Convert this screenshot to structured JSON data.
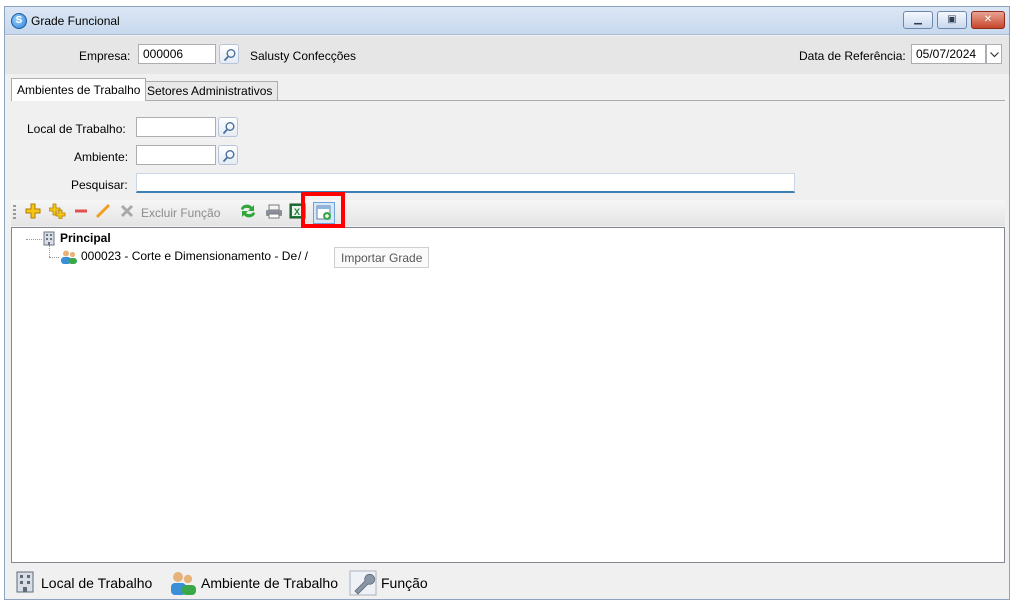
{
  "window": {
    "title": "Grade Funcional"
  },
  "header": {
    "empresa_label": "Empresa:",
    "empresa_code": "000006",
    "empresa_name": "Salusty Confecções",
    "data_ref_label": "Data de Referência:",
    "data_ref_value": "05/07/2024"
  },
  "tabs": [
    {
      "label": "Ambientes de Trabalho",
      "active": true
    },
    {
      "label": "Setores Administrativos",
      "active": false
    }
  ],
  "filters": {
    "local_label": "Local de Trabalho:",
    "local_value": "",
    "ambiente_label": "Ambiente:",
    "ambiente_value": "",
    "pesquisar_label": "Pesquisar:",
    "pesquisar_value": ""
  },
  "toolbar": {
    "excluir_label": "Excluir Função",
    "icons": [
      "add-icon",
      "add-child-icon",
      "remove-icon",
      "edit-icon",
      "delete-icon",
      "refresh-icon",
      "print-icon",
      "excel-icon",
      "import-grade-icon"
    ]
  },
  "tree": {
    "root_label": "Principal",
    "child_label": "000023 - Corte e Dimensionamento - De",
    "child_date": "/ /",
    "tooltip": "Importar Grade"
  },
  "legend": {
    "local": "Local de Trabalho",
    "ambiente": "Ambiente de Trabalho",
    "funcao": "Função"
  },
  "colors": {
    "highlight": "#ff0000",
    "focus_border": "#3c7fb1"
  }
}
